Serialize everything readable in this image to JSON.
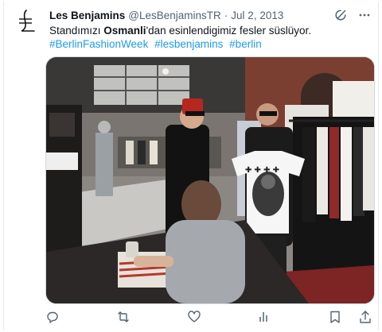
{
  "tweet": {
    "author_name": "Les Benjamins",
    "handle": "@LesBenjaminsTR",
    "separator": "·",
    "date": "Jul 2, 2013",
    "text_before": "Standımızı ",
    "text_bold": "Osmanli",
    "text_after": "'dan esinlendigimiz fesler süslüyor.",
    "hashtags": [
      "#BerlinFashionWeek",
      "#lesbenjamins",
      "#berlin"
    ]
  },
  "icons": {
    "avatar": "les-benjamins-logo",
    "header": [
      "grok-icon",
      "more-icon"
    ],
    "actions_left": [
      "reply-icon",
      "retweet-icon",
      "like-icon",
      "views-icon"
    ],
    "actions_right": [
      "bookmark-icon",
      "share-icon"
    ]
  },
  "colors": {
    "text": "#0f1419",
    "muted": "#536471",
    "link": "#1d9bf0",
    "fez": "#b5271f"
  }
}
